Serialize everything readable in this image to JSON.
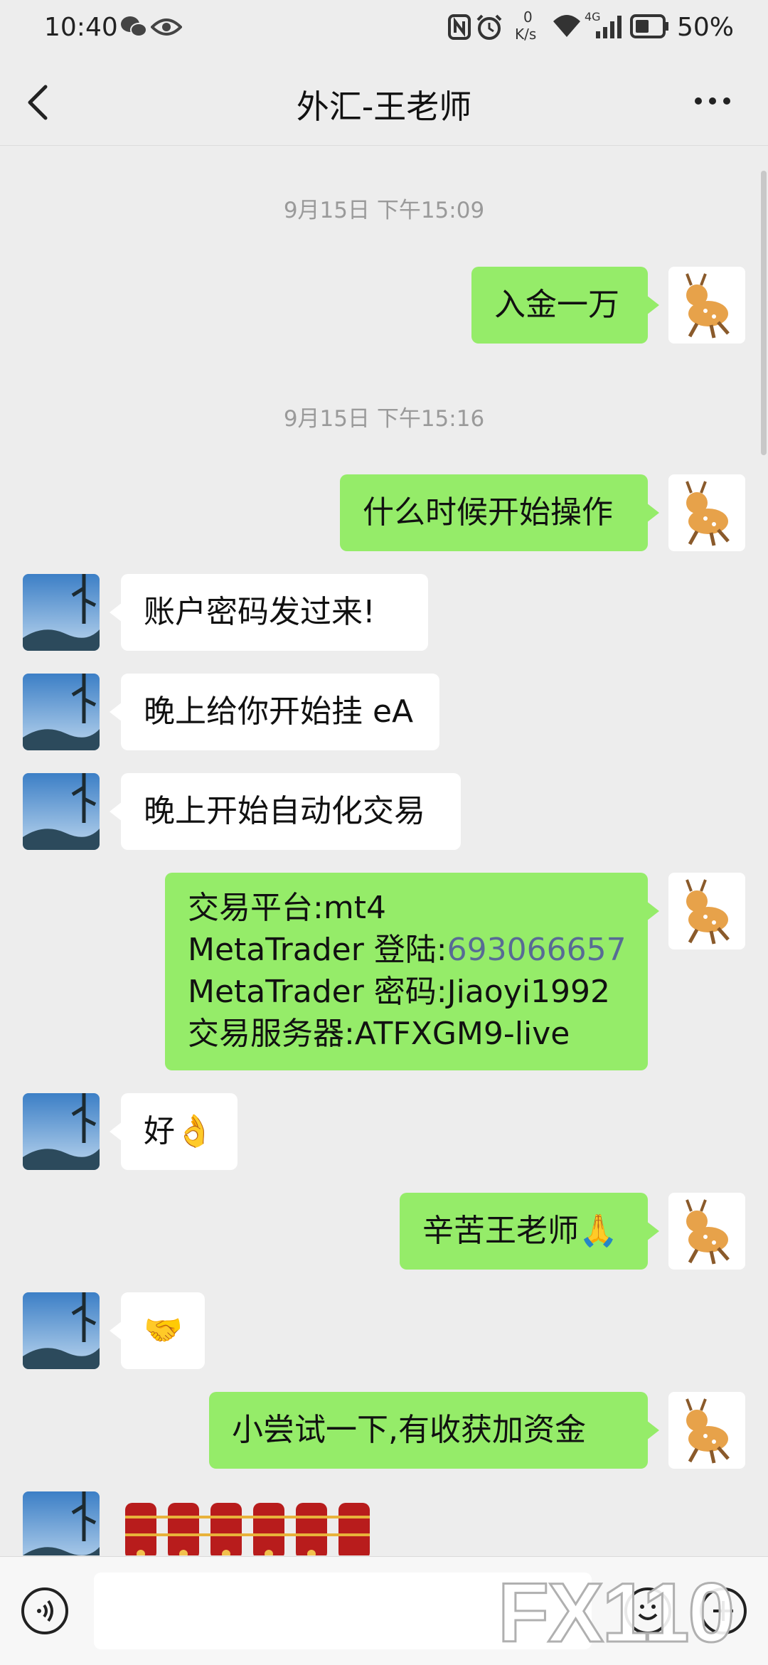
{
  "status_bar": {
    "time": "10:40",
    "net_speed_top": "0",
    "net_speed_unit": "K/s",
    "signal_label": "4G",
    "battery": "50%"
  },
  "header": {
    "title": "外汇-王老师"
  },
  "timestamps": [
    "9月15日 下午15:09",
    "9月15日 下午15:16"
  ],
  "messages": [
    {
      "side": "me",
      "text": "入金一万"
    },
    {
      "side": "me",
      "text": "什么时候开始操作"
    },
    {
      "side": "them",
      "text": "账户密码发过来!"
    },
    {
      "side": "them",
      "text": "晚上给你开始挂 eA"
    },
    {
      "side": "them",
      "text": "晚上开始自动化交易"
    },
    {
      "side": "me",
      "lines": [
        {
          "label": "交易平台:",
          "value": "mt4"
        },
        {
          "label": "MetaTrader 登陆:",
          "value": "693066657"
        },
        {
          "label": "MetaTrader 密码:",
          "value": "Jiaoyi1992"
        },
        {
          "label": "交易服务器:",
          "value": "ATFXGM9-live"
        }
      ]
    },
    {
      "side": "them",
      "text": "好👌"
    },
    {
      "side": "me",
      "text": "辛苦王老师🙏"
    },
    {
      "side": "them",
      "text": "🤝"
    },
    {
      "side": "me",
      "text": "小尝试一下,有收获加资金"
    },
    {
      "side": "them",
      "sticker": "firecracker-sticker"
    }
  ],
  "input": {
    "placeholder": ""
  },
  "watermark": "FX110",
  "colors": {
    "background": "#ededed",
    "my_bubble": "#95ec69",
    "their_bubble": "#ffffff",
    "link": "#576b95"
  },
  "icons": [
    "back-icon",
    "more-icon",
    "wechat-icon",
    "eye-icon",
    "nfc-icon",
    "alarm-icon",
    "wifi-icon",
    "signal-icon",
    "battery-icon",
    "voice-icon",
    "emoji-icon",
    "plus-icon"
  ]
}
